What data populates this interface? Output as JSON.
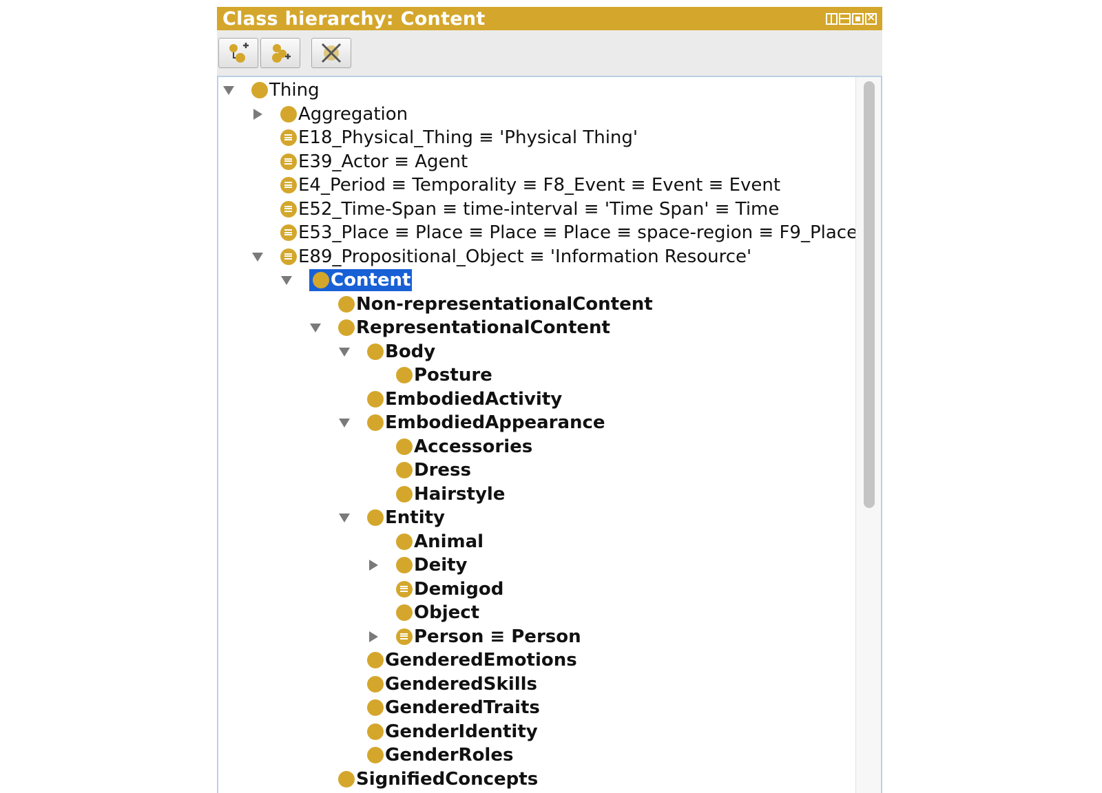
{
  "window": {
    "title": "Class hierarchy: Content"
  },
  "toolbar": {
    "buttons": [
      {
        "icon": "add-subclass-icon"
      },
      {
        "icon": "add-sibling-class-icon"
      },
      {
        "icon": "delete-class-icon"
      }
    ]
  },
  "colors": {
    "titlebar": "#d4a72c",
    "class_icon": "#d4a72c",
    "selection": "#1860d5"
  },
  "tree": {
    "rows": [
      {
        "label": "Thing",
        "level": 0,
        "expander": "expanded",
        "icon": "class",
        "bold": false
      },
      {
        "label": "Aggregation",
        "level": 1,
        "expander": "collapsed",
        "icon": "class",
        "bold": false
      },
      {
        "label": "E18_Physical_Thing ≡ 'Physical Thing'",
        "level": 1,
        "expander": "none",
        "icon": "equivalent",
        "bold": false
      },
      {
        "label": "E39_Actor ≡ Agent",
        "level": 1,
        "expander": "none",
        "icon": "equivalent",
        "bold": false
      },
      {
        "label": "E4_Period ≡ Temporality ≡ F8_Event ≡ Event ≡ Event",
        "level": 1,
        "expander": "none",
        "icon": "equivalent",
        "bold": false
      },
      {
        "label": "E52_Time-Span ≡ time-interval ≡ 'Time Span' ≡ Time",
        "level": 1,
        "expander": "none",
        "icon": "equivalent",
        "bold": false
      },
      {
        "label": "E53_Place ≡ Place ≡ Place ≡ Place ≡ space-region ≡ F9_Place",
        "level": 1,
        "expander": "none",
        "icon": "equivalent",
        "bold": false
      },
      {
        "label": "E89_Propositional_Object ≡ 'Information Resource'",
        "level": 1,
        "expander": "expanded",
        "icon": "equivalent",
        "bold": false
      },
      {
        "label": "Content",
        "level": 2,
        "expander": "expanded",
        "icon": "class",
        "bold": true,
        "selected": true
      },
      {
        "label": "Non-representationalContent",
        "level": 3,
        "expander": "none",
        "icon": "class",
        "bold": true
      },
      {
        "label": "RepresentationalContent",
        "level": 3,
        "expander": "expanded",
        "icon": "class",
        "bold": true
      },
      {
        "label": "Body",
        "level": 4,
        "expander": "expanded",
        "icon": "class",
        "bold": true
      },
      {
        "label": "Posture",
        "level": 5,
        "expander": "none",
        "icon": "class",
        "bold": true
      },
      {
        "label": "EmbodiedActivity",
        "level": 4,
        "expander": "none",
        "icon": "class",
        "bold": true
      },
      {
        "label": "EmbodiedAppearance",
        "level": 4,
        "expander": "expanded",
        "icon": "class",
        "bold": true
      },
      {
        "label": "Accessories",
        "level": 5,
        "expander": "none",
        "icon": "class",
        "bold": true
      },
      {
        "label": "Dress",
        "level": 5,
        "expander": "none",
        "icon": "class",
        "bold": true
      },
      {
        "label": "Hairstyle",
        "level": 5,
        "expander": "none",
        "icon": "class",
        "bold": true
      },
      {
        "label": "Entity",
        "level": 4,
        "expander": "expanded",
        "icon": "class",
        "bold": true
      },
      {
        "label": "Animal",
        "level": 5,
        "expander": "none",
        "icon": "class",
        "bold": true
      },
      {
        "label": "Deity",
        "level": 5,
        "expander": "collapsed",
        "icon": "class",
        "bold": true
      },
      {
        "label": "Demigod",
        "level": 5,
        "expander": "none",
        "icon": "equivalent",
        "bold": true
      },
      {
        "label": "Object",
        "level": 5,
        "expander": "none",
        "icon": "class",
        "bold": true
      },
      {
        "label": "Person ≡ Person",
        "level": 5,
        "expander": "collapsed",
        "icon": "equivalent",
        "bold": true
      },
      {
        "label": "GenderedEmotions",
        "level": 4,
        "expander": "none",
        "icon": "class",
        "bold": true
      },
      {
        "label": "GenderedSkills",
        "level": 4,
        "expander": "none",
        "icon": "class",
        "bold": true
      },
      {
        "label": "GenderedTraits",
        "level": 4,
        "expander": "none",
        "icon": "class",
        "bold": true
      },
      {
        "label": "GenderIdentity",
        "level": 4,
        "expander": "none",
        "icon": "class",
        "bold": true
      },
      {
        "label": "GenderRoles",
        "level": 4,
        "expander": "none",
        "icon": "class",
        "bold": true
      },
      {
        "label": "SignifiedConcepts",
        "level": 3,
        "expander": "none",
        "icon": "class",
        "bold": true
      }
    ]
  }
}
